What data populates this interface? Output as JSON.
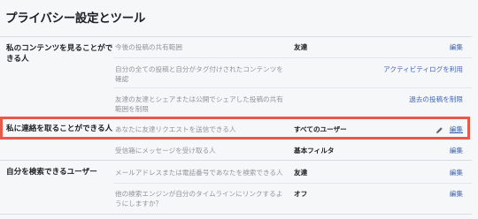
{
  "page": {
    "title": "プライバシー設定とツール"
  },
  "sections": [
    {
      "label_lines": [
        "私のコンテンツを見ることがで",
        "きる人"
      ],
      "rows": [
        {
          "desc_lines": [
            "今後の投稿の共有範囲"
          ],
          "value": "友達",
          "action": "編集"
        },
        {
          "desc_lines": [
            "自分の全ての投稿と自分がタグ付けされたコンテンツを",
            "確認"
          ],
          "value": "",
          "action": "アクティビティログを利用"
        },
        {
          "desc_lines": [
            "友達の友達とシェアまたは公開でシェアした投稿の共有",
            "範囲を制限"
          ],
          "value": "",
          "action": "過去の投稿を制限"
        }
      ]
    },
    {
      "label_lines": [
        "私に連絡を取ることができる人"
      ],
      "rows": [
        {
          "desc_lines": [
            "あなたに友達リクエストを送信できる人"
          ],
          "value": "すべてのユーザー",
          "action": "編集"
        },
        {
          "desc_lines": [
            "受信箱にメッセージを受け取る人"
          ],
          "value": "基本フィルタ",
          "action": "編集"
        }
      ]
    },
    {
      "label_lines": [
        "自分を検索できるユーザー"
      ],
      "rows": [
        {
          "desc_lines": [
            "メールアドレスまたは電話番号であなたを検索できる人"
          ],
          "value": "友達",
          "action": "編集"
        },
        {
          "desc_lines": [
            "他の検索エンジンが自分のタイムラインにリンクするよ",
            "うにしますか？"
          ],
          "value": "オフ",
          "action": "編集"
        }
      ]
    }
  ],
  "colors": {
    "highlight": "#e8594a",
    "link": "#4267b2"
  },
  "icons": {
    "edit": "pencil-icon"
  }
}
